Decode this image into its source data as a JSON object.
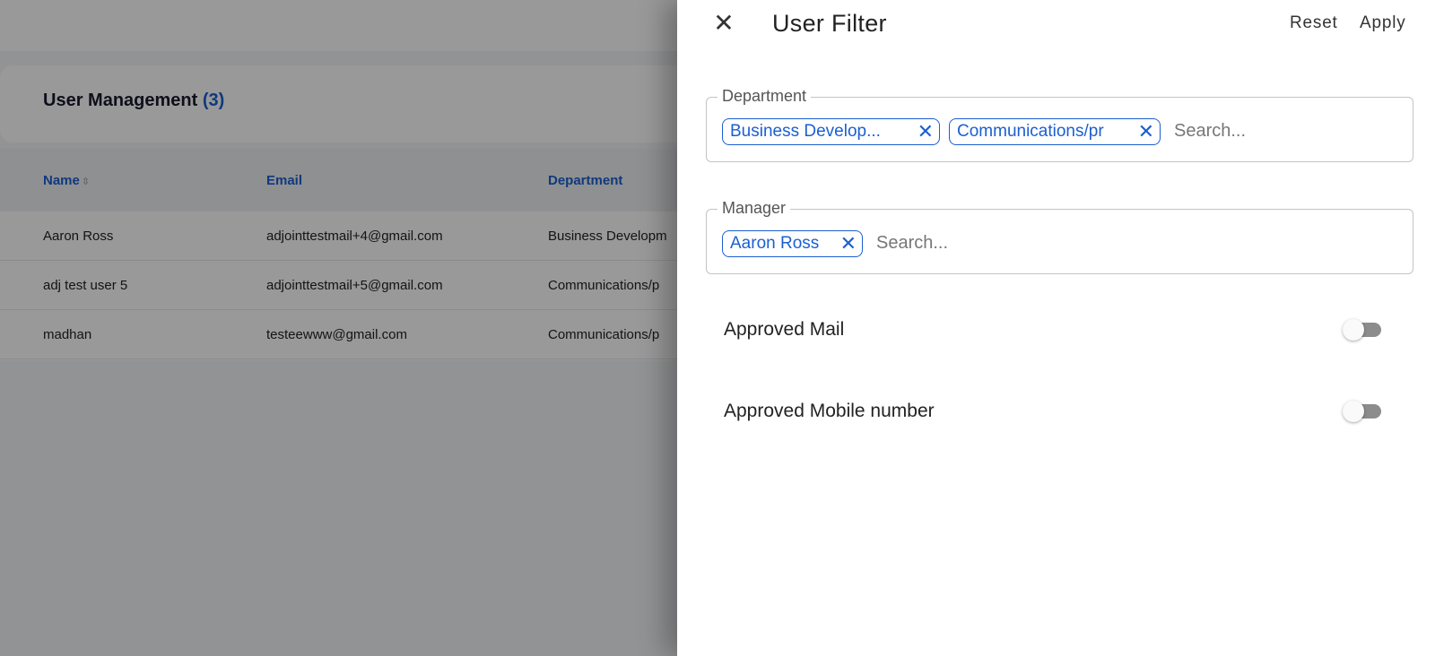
{
  "background": {
    "page_title": "User Management",
    "user_count": "(3)",
    "table": {
      "columns": [
        "Name",
        "Email",
        "Department"
      ],
      "sort_icon": "⇳",
      "rows": [
        {
          "name": "Aaron Ross",
          "email": "adjointtestmail+4@gmail.com",
          "department": "Business Developm"
        },
        {
          "name": "adj test user 5",
          "email": "adjointtestmail+5@gmail.com",
          "department": "Communications/p"
        },
        {
          "name": "madhan",
          "email": "testeewww@gmail.com",
          "department": "Communications/p"
        }
      ]
    }
  },
  "drawer": {
    "title": "User Filter",
    "close_icon": "✕",
    "reset_label": "Reset",
    "apply_label": "Apply",
    "department": {
      "legend": "Department",
      "chips": [
        "Business Develop...",
        "Communications/pr"
      ],
      "placeholder": "Search..."
    },
    "manager": {
      "legend": "Manager",
      "chips": [
        "Aaron Ross"
      ],
      "placeholder": "Search..."
    },
    "chip_remove_icon": "✕",
    "toggles": [
      {
        "label": "Approved Mail",
        "checked": false
      },
      {
        "label": "Approved Mobile number",
        "checked": false
      }
    ]
  }
}
